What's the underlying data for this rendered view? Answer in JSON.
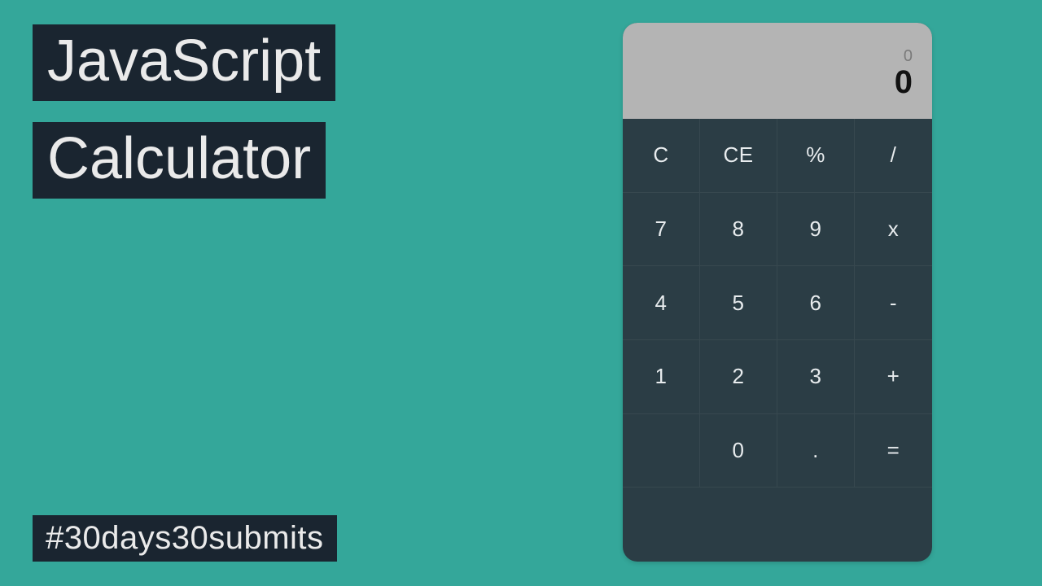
{
  "title": {
    "line1": "JavaScript",
    "line2": "Calculator"
  },
  "hashtag": "#30days30submits",
  "display": {
    "secondary": "0",
    "primary": "0"
  },
  "keys": {
    "clear": "C",
    "clear_entry": "CE",
    "percent": "%",
    "divide": "/",
    "seven": "7",
    "eight": "8",
    "nine": "9",
    "multiply": "x",
    "four": "4",
    "five": "5",
    "six": "6",
    "subtract": "-",
    "one": "1",
    "two": "2",
    "three": "3",
    "add": "+",
    "zero": "0",
    "decimal": ".",
    "equals": "="
  }
}
